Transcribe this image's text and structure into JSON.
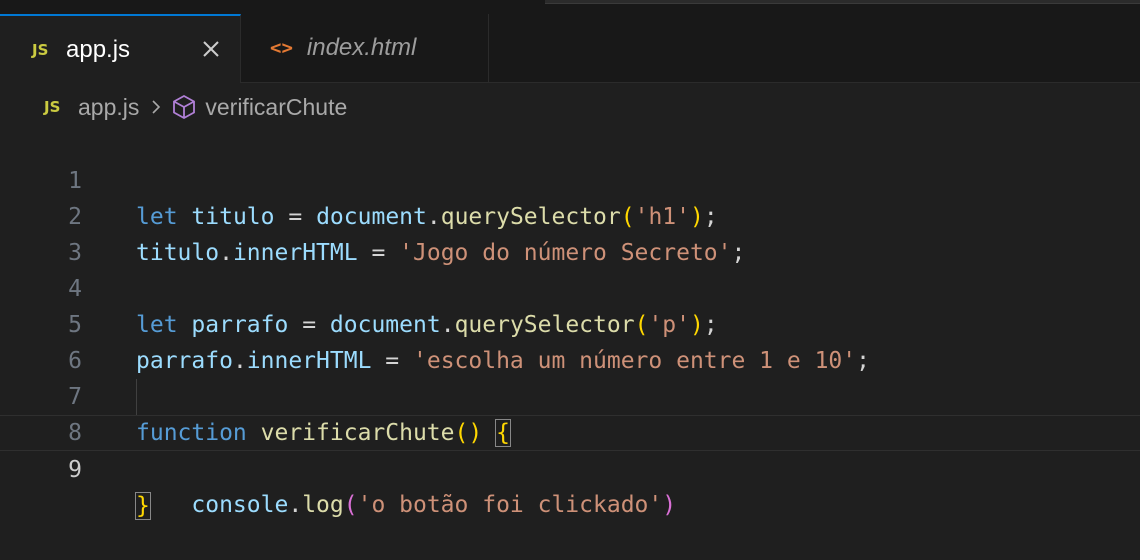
{
  "tabs": [
    {
      "icon": "JS",
      "label": "app.js",
      "active": true
    },
    {
      "icon": "<>",
      "label": "index.html",
      "active": false
    }
  ],
  "breadcrumb": {
    "file_icon": "JS",
    "file": "app.js",
    "symbol": "verificarChute"
  },
  "editor": {
    "current_line": 9,
    "lines": [
      {
        "n": "1",
        "tokens": [
          "let",
          "titulo",
          "=",
          "document",
          ".",
          "querySelector",
          "(",
          "'h1'",
          ")",
          ";"
        ]
      },
      {
        "n": "2",
        "tokens": [
          "titulo",
          ".",
          "innerHTML",
          "=",
          "'Jogo do número Secreto'",
          ";"
        ]
      },
      {
        "n": "3",
        "tokens": []
      },
      {
        "n": "4",
        "tokens": [
          "let",
          "parrafo",
          "=",
          "document",
          ".",
          "querySelector",
          "(",
          "'p'",
          ")",
          ";"
        ]
      },
      {
        "n": "5",
        "tokens": [
          "parrafo",
          ".",
          "innerHTML",
          "=",
          "'escolha um número entre 1 e 10'",
          ";"
        ]
      },
      {
        "n": "6",
        "tokens": []
      },
      {
        "n": "7",
        "tokens": [
          "function",
          "verificarChute",
          "(",
          ")",
          "{"
        ]
      },
      {
        "n": "8",
        "tokens": [
          "console",
          ".",
          "log",
          "(",
          "'o botão foi clickado'",
          ")"
        ]
      },
      {
        "n": "9",
        "tokens": [
          "}"
        ]
      }
    ]
  },
  "colors": {
    "accent": "#0078d4",
    "keyword": "#569cd6",
    "variable": "#9cdcfe",
    "function": "#dcdcaa",
    "string": "#ce9178",
    "bracket_level1": "#ffd700",
    "bracket_level2": "#da70d6",
    "js_badge": "#cbcb41",
    "html_icon": "#e37933"
  }
}
